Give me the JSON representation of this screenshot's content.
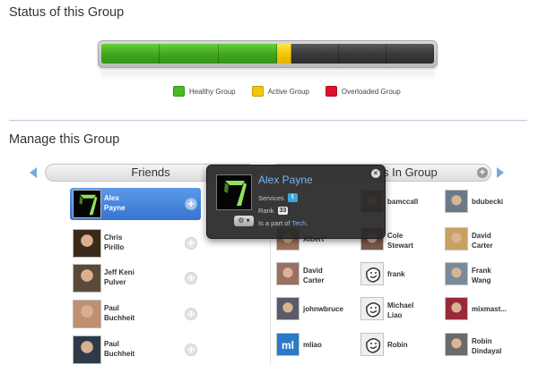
{
  "status": {
    "title": "Status of this Group",
    "bar": {
      "segments": [
        "healthy",
        "healthy",
        "healthy",
        "active",
        "empty",
        "empty",
        "empty"
      ],
      "colors": {
        "healthy": "#43aa21",
        "active": "#f2c400",
        "empty": "#3a3a3a"
      }
    },
    "legend": [
      {
        "label": "Healthy Group",
        "color": "#44bb22"
      },
      {
        "label": "Active Group",
        "color": "#f2c800"
      },
      {
        "label": "Overloaded Group",
        "color": "#e0102a"
      }
    ]
  },
  "manage": {
    "title": "Manage this Group",
    "friends_header": "Friends",
    "group_header_partial": "s In Group",
    "friends": [
      {
        "first": "Alex",
        "last": "Payne",
        "avatar": "digit-seven-avatar",
        "selected": true
      },
      {
        "first": "Chris",
        "last": "Pirillo",
        "avatar": "portrait-avatar",
        "selected": false
      },
      {
        "first": "Jeff Keni",
        "last": "Pulver",
        "avatar": "portrait-avatar",
        "selected": false
      },
      {
        "first": "Paul",
        "last": "Buchheit",
        "avatar": "portrait-avatar",
        "selected": false
      },
      {
        "first": "Paul",
        "last": "Buchheit",
        "avatar": "portrait-avatar",
        "selected": false
      }
    ],
    "members": [
      {
        "line1": "bamccall",
        "line2": "",
        "avatar": "photo",
        "color": "#8a6a55"
      },
      {
        "line1": "bdubecki",
        "line2": "",
        "avatar": "photo",
        "color": "#6b7a8a"
      },
      {
        "line1": "Albert",
        "line2": "",
        "avatar": "photo",
        "color": "#a0705a"
      },
      {
        "line1": "Cole",
        "line2": "Stewart",
        "avatar": "photo",
        "color": "#7a5a4a"
      },
      {
        "line1": "David",
        "line2": "Carter",
        "avatar": "photo",
        "color": "#c8a060"
      },
      {
        "line1": "David",
        "line2": "Carter",
        "avatar": "photo",
        "color": "#9a7060"
      },
      {
        "line1": "frank",
        "line2": "",
        "avatar": "default-face",
        "color": "#e6e6e6"
      },
      {
        "line1": "Frank",
        "line2": "Wang",
        "avatar": "photo",
        "color": "#7a8a9a"
      },
      {
        "line1": "johnwbruce",
        "line2": "",
        "avatar": "photo",
        "color": "#5a5a6a"
      },
      {
        "line1": "Michael",
        "line2": "Liao",
        "avatar": "default-face",
        "color": "#e6e6e6"
      },
      {
        "line1": "mixmast...",
        "line2": "",
        "avatar": "photo",
        "color": "#9a2a3a"
      },
      {
        "line1": "mliao",
        "line2": "",
        "avatar": "ml-logo",
        "color": "#2a7ac8"
      },
      {
        "line1": "Robin",
        "line2": "",
        "avatar": "default-face",
        "color": "#e6e6e6"
      },
      {
        "line1": "Robin",
        "line2": "Dindayal",
        "avatar": "photo",
        "color": "#6a6a6a"
      }
    ],
    "popup": {
      "name": "Alex Payne",
      "services_label": "Services",
      "twitter_glyph": "t",
      "rank_label": "Rank",
      "rank_value": "33",
      "part_of_prefix": "Is a part of",
      "part_of_link": "Tech",
      "part_of_suffix": ".",
      "close_glyph": "×",
      "gear_glyph": "⚙ ▾"
    },
    "add_glyph": "+",
    "icons": {
      "nav_left": "triangle-left-icon",
      "nav_right": "triangle-right-icon",
      "add": "plus-circle-icon",
      "twitter": "twitter-icon",
      "gear": "gear-icon",
      "close": "close-icon"
    }
  }
}
